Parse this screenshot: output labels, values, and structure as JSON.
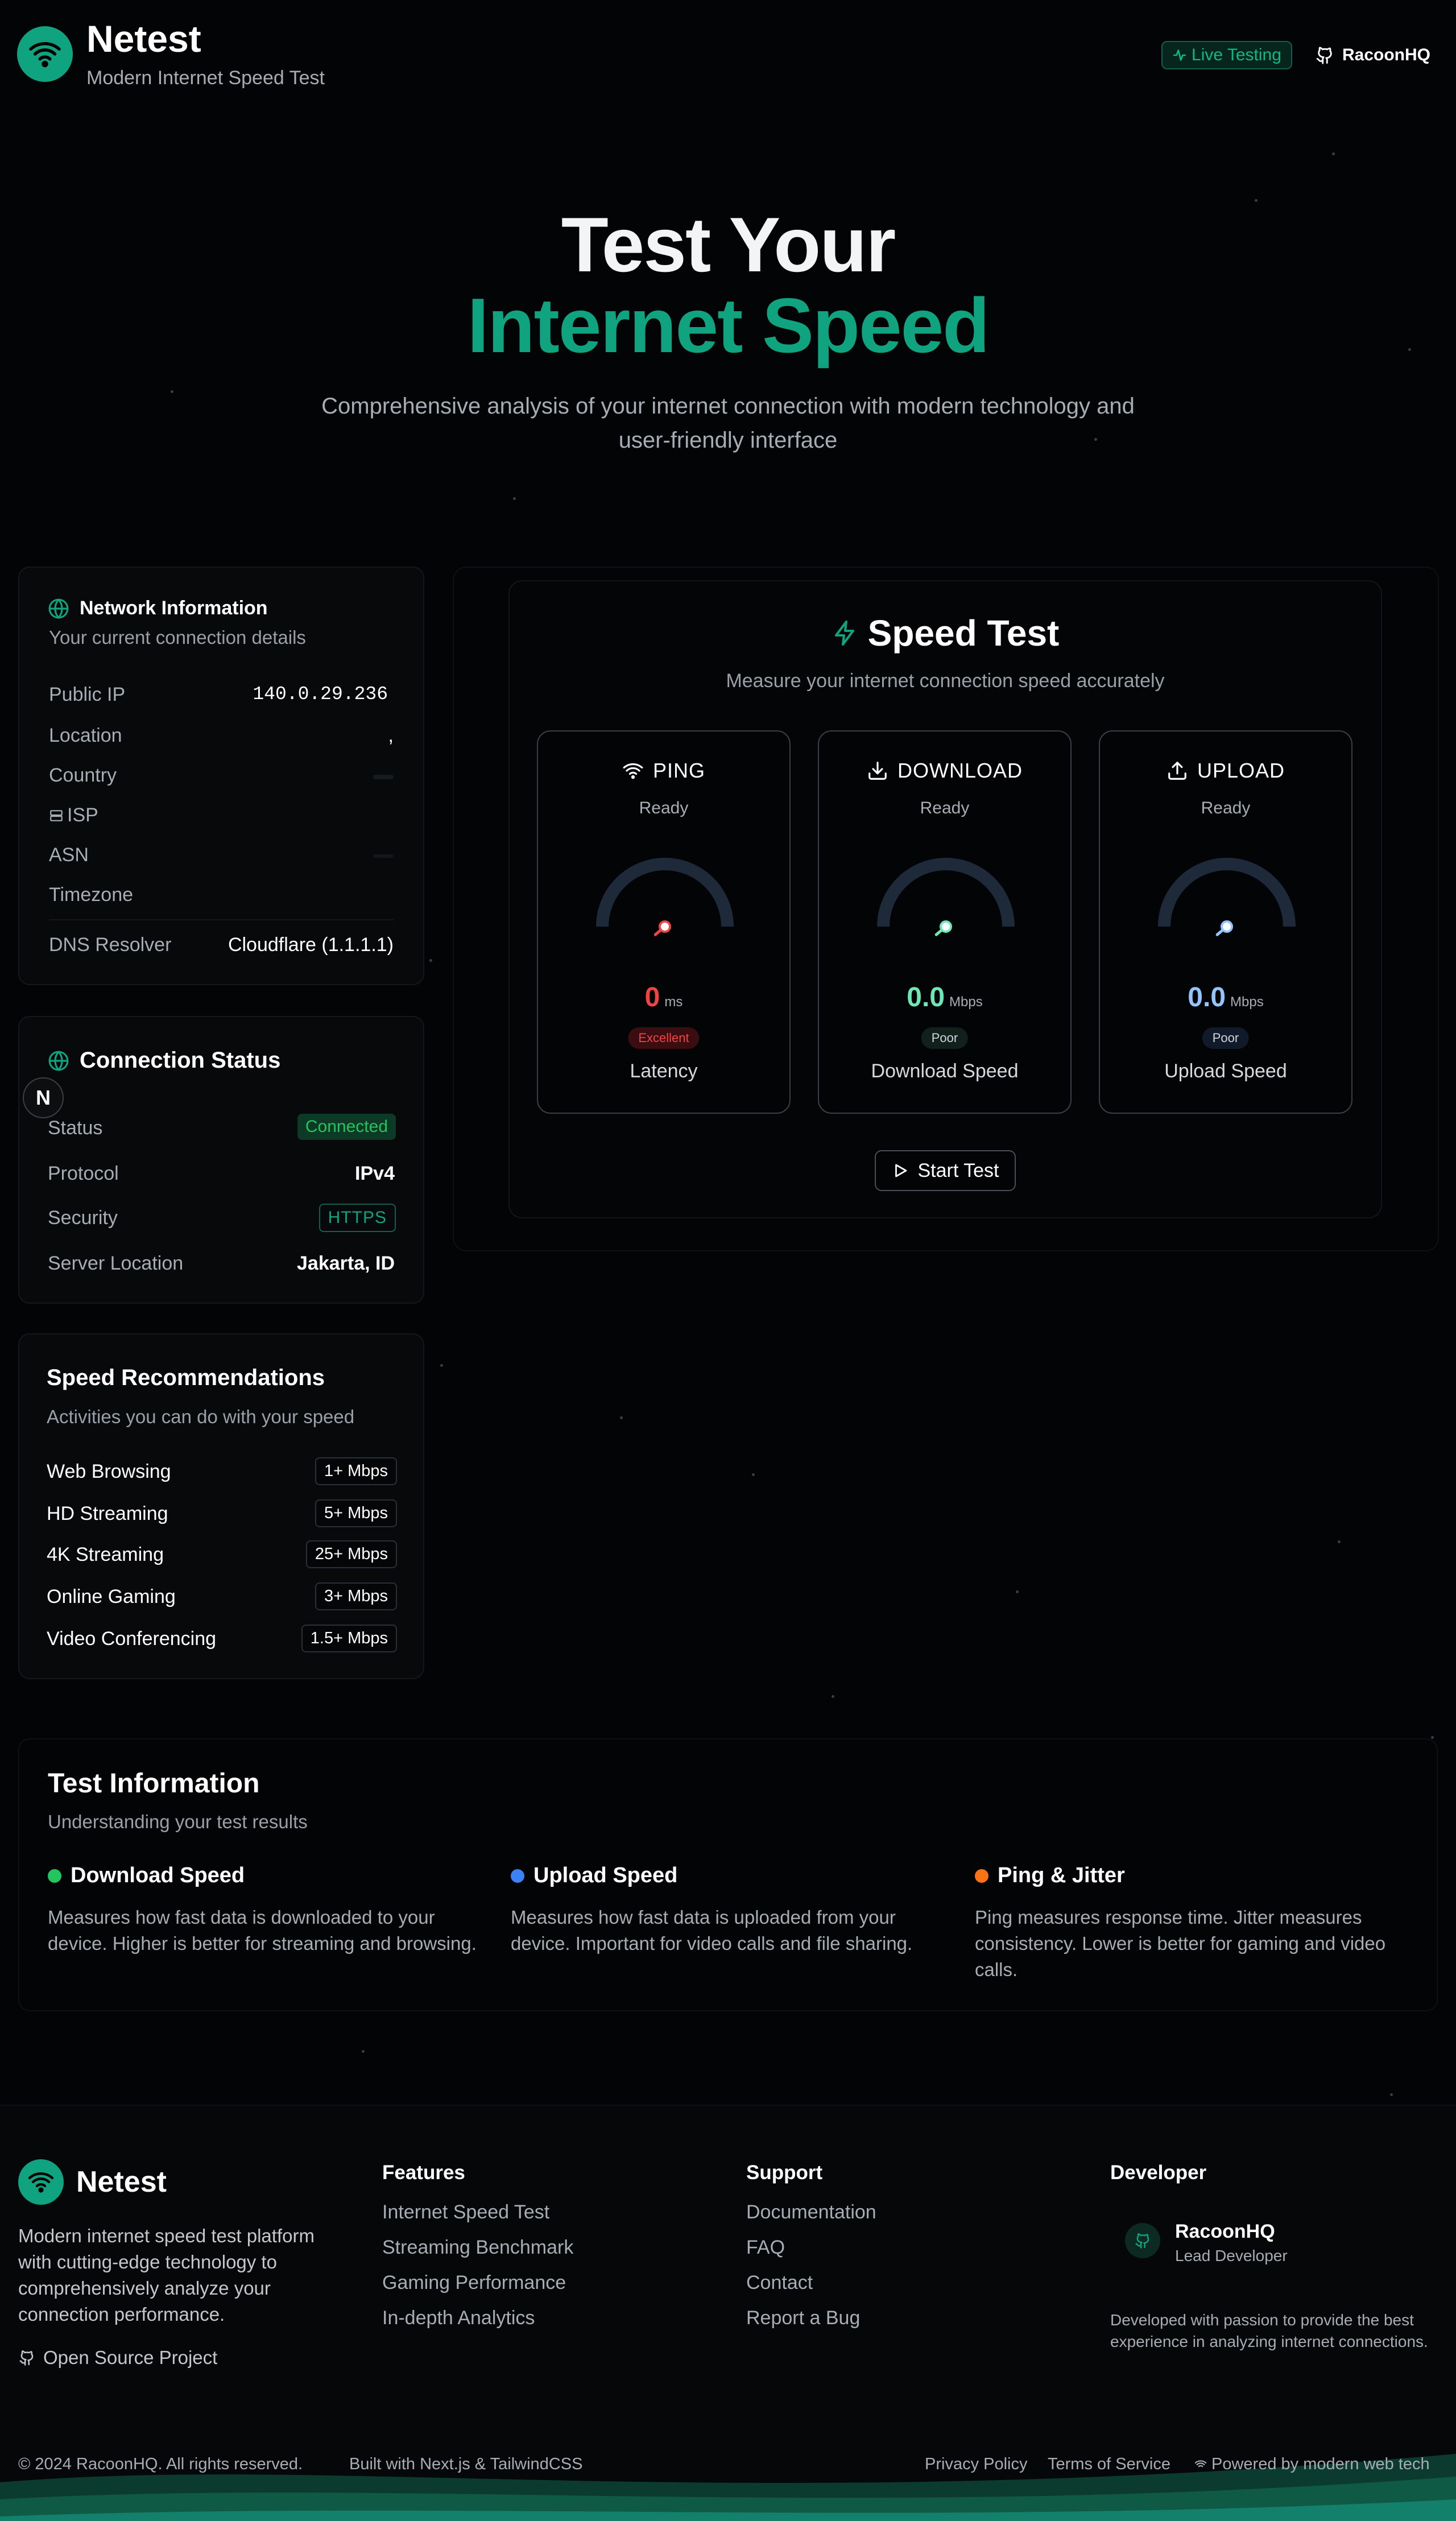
{
  "header": {
    "brand": "Netest",
    "tagline": "Modern Internet Speed Test",
    "live_badge": "Live Testing",
    "github_label": "RacoonHQ"
  },
  "hero": {
    "line1": "Test Your",
    "line2": "Internet Speed",
    "subtitle": "Comprehensive analysis of your internet connection with modern technology and user-friendly interface"
  },
  "network": {
    "title": "Network Information",
    "subtitle": "Your current connection details",
    "rows": [
      {
        "label": "Public IP",
        "value": "140.0.29.236"
      },
      {
        "label": "Location",
        "value": ","
      },
      {
        "label": "Country",
        "value": ""
      },
      {
        "label": "ISP",
        "value": ""
      },
      {
        "label": "ASN",
        "value": ""
      },
      {
        "label": "Timezone",
        "value": ""
      },
      {
        "label": "DNS Resolver",
        "value": "Cloudflare (1.1.1.1)"
      }
    ]
  },
  "connection": {
    "title": "Connection Status",
    "rows": [
      {
        "label": "Status",
        "value": "Connected"
      },
      {
        "label": "Protocol",
        "value": "IPv4"
      },
      {
        "label": "Security",
        "value": "HTTPS"
      },
      {
        "label": "Server Location",
        "value": "Jakarta, ID"
      }
    ],
    "floating_badge": "N"
  },
  "recommendations": {
    "title": "Speed Recommendations",
    "subtitle": "Activities you can do with your speed",
    "items": [
      {
        "label": "Web Browsing",
        "value": "1+ Mbps"
      },
      {
        "label": "HD Streaming",
        "value": "5+ Mbps"
      },
      {
        "label": "4K Streaming",
        "value": "25+ Mbps"
      },
      {
        "label": "Online Gaming",
        "value": "3+ Mbps"
      },
      {
        "label": "Video Conferencing",
        "value": "1.5+ Mbps"
      }
    ]
  },
  "speed_test": {
    "title": "Speed Test",
    "subtitle": "Measure your internet connection speed accurately",
    "gauges": [
      {
        "title": "PING",
        "state": "Ready",
        "value": "0",
        "unit": "ms",
        "rating": "Excellent",
        "name": "Latency",
        "level": 0,
        "color": "#ef4444",
        "icon": "wifi-icon"
      },
      {
        "title": "DOWNLOAD",
        "state": "Ready",
        "value": "0.0",
        "unit": "Mbps",
        "rating": "Poor",
        "name": "Download Speed",
        "level": 0,
        "color": "#6ee7b7",
        "icon": "download-icon"
      },
      {
        "title": "UPLOAD",
        "state": "Ready",
        "value": "0.0",
        "unit": "Mbps",
        "rating": "Poor",
        "name": "Upload Speed",
        "level": 0,
        "color": "#93c5fd",
        "icon": "upload-icon"
      }
    ],
    "start_label": "Start Test"
  },
  "test_info": {
    "title": "Test Information",
    "subtitle": "Understanding your test results",
    "items": [
      {
        "title": "Download Speed",
        "color": "#22c55e",
        "text": "Measures how fast data is downloaded to your device. Higher is better for streaming and browsing."
      },
      {
        "title": "Upload Speed",
        "color": "#3b82f6",
        "text": "Measures how fast data is uploaded from your device. Important for video calls and file sharing."
      },
      {
        "title": "Ping & Jitter",
        "color": "#f97316",
        "text": "Ping measures response time. Jitter measures consistency. Lower is better for gaming and video calls."
      }
    ]
  },
  "footer": {
    "brand": "Netest",
    "description": "Modern internet speed test platform with cutting-edge technology to comprehensively analyze your connection performance.",
    "open_source": "Open Source Project",
    "features_title": "Features",
    "features": [
      "Internet Speed Test",
      "Streaming Benchmark",
      "Gaming Performance",
      "In-depth Analytics"
    ],
    "support_title": "Support",
    "support": [
      "Documentation",
      "FAQ",
      "Contact",
      "Report a Bug"
    ],
    "developer_title": "Developer",
    "dev_name": "RacoonHQ",
    "dev_role": "Lead Developer",
    "dev_note": "Developed with passion to provide the best experience in analyzing internet connections.",
    "copyright": "© 2024 RacoonHQ. All rights reserved.",
    "built_with": "Built with Next.js & TailwindCSS",
    "privacy": "Privacy Policy",
    "terms": "Terms of Service",
    "powered": "Powered by modern web tech"
  },
  "colors": {
    "accent": "#10a37f",
    "background": "#030405"
  }
}
